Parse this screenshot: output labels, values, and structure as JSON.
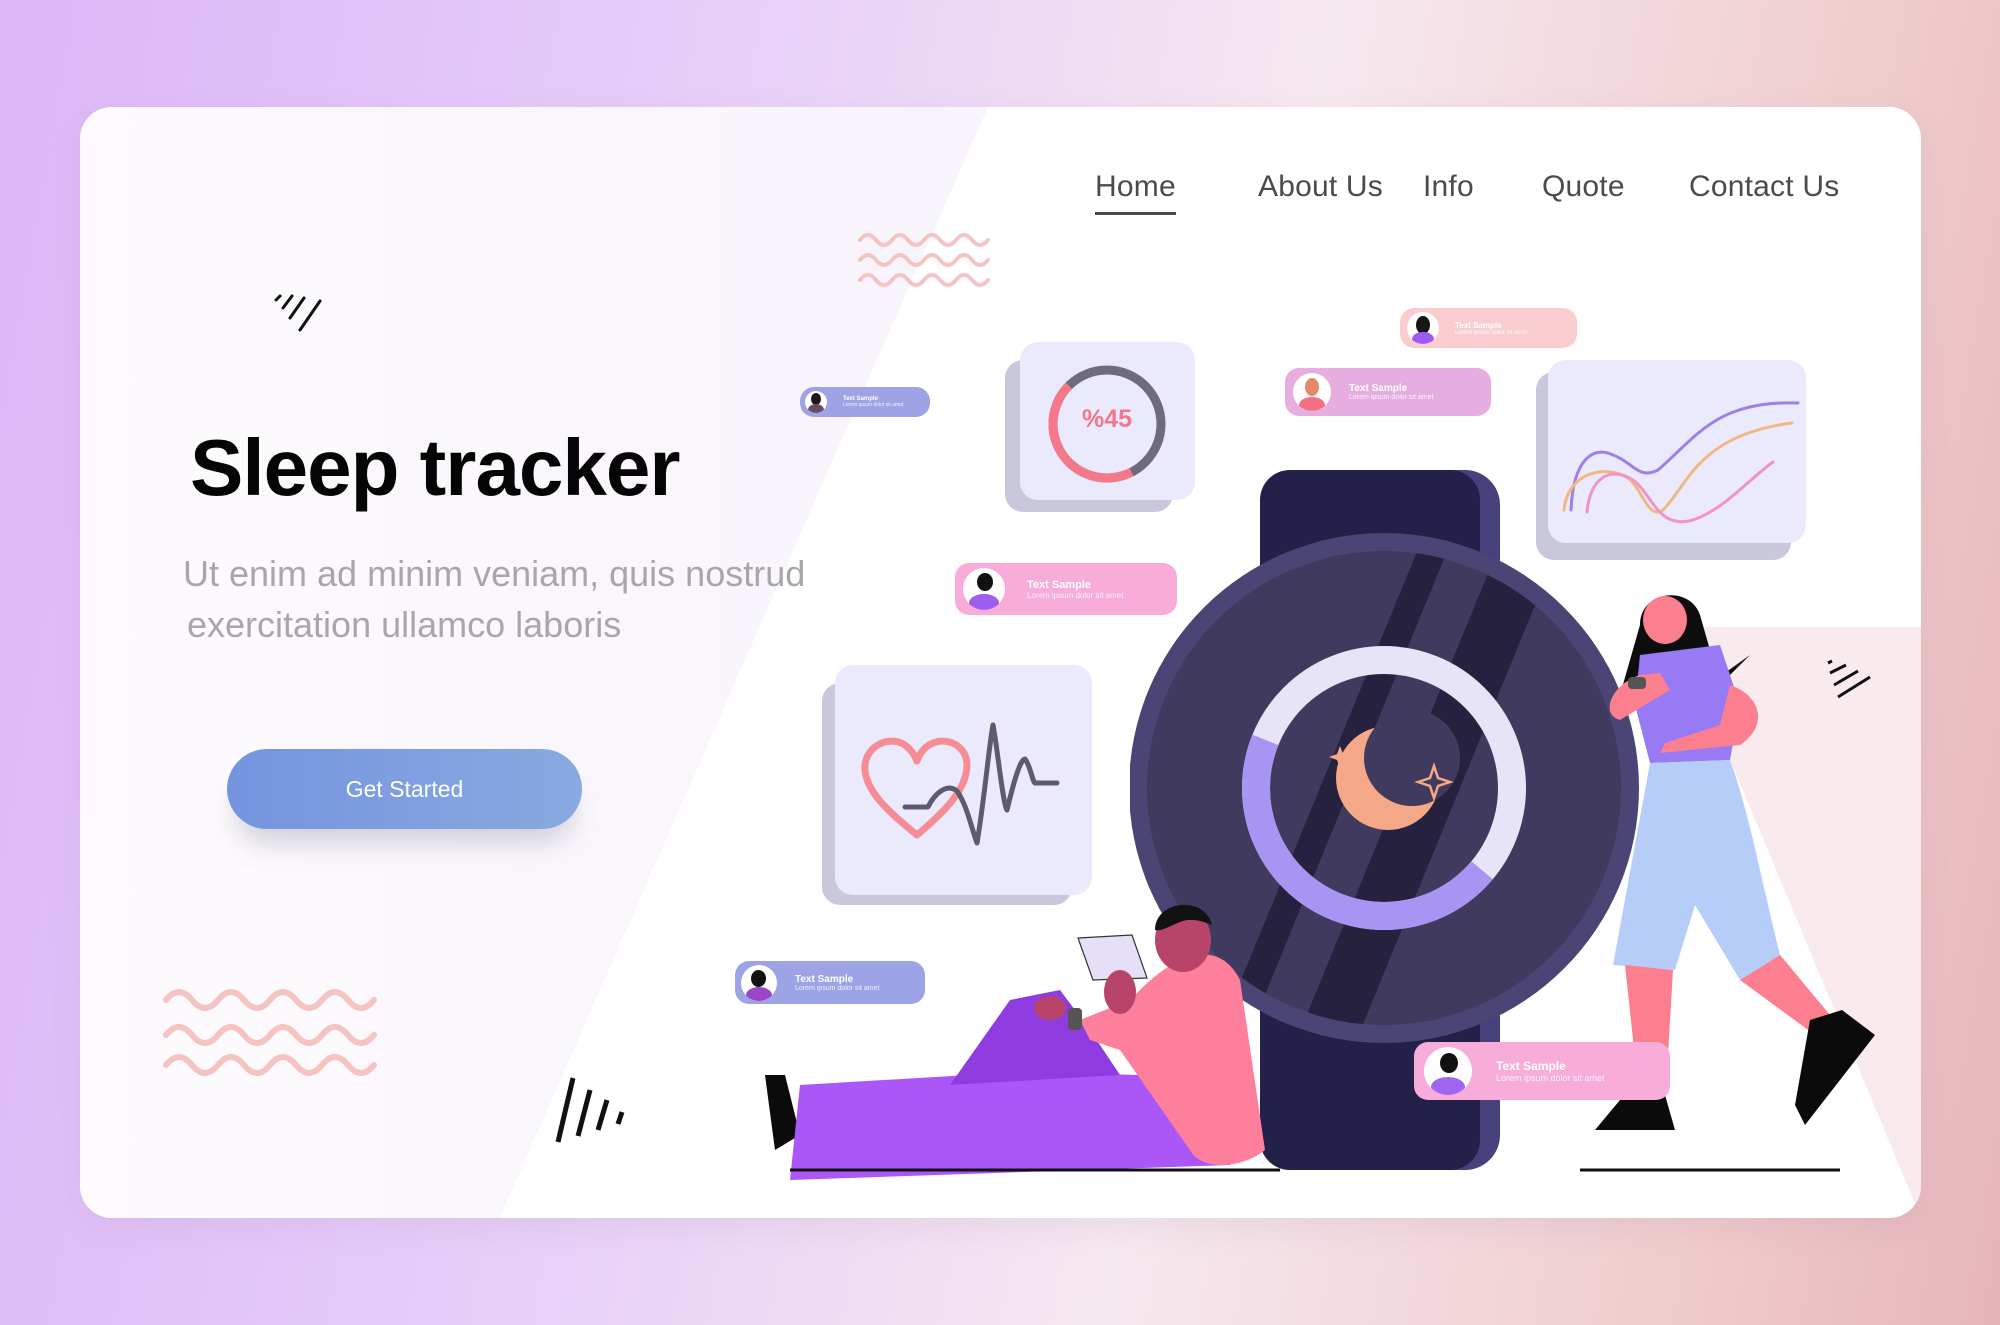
{
  "nav": {
    "items": [
      {
        "label": "Home",
        "active": true
      },
      {
        "label": "About Us",
        "active": false
      },
      {
        "label": "Info",
        "active": false
      },
      {
        "label": "Quote",
        "active": false
      },
      {
        "label": "Contact Us",
        "active": false
      }
    ]
  },
  "hero": {
    "title": "Sleep tracker",
    "subtitle_line1": "Ut enim ad minim veniam, quis nostrud",
    "subtitle_line2": "exercitation ullamco laboris",
    "cta_label": "Get Started"
  },
  "widgets": {
    "progress": {
      "label": "%45",
      "value_percent": 45
    },
    "watch_ring": {
      "progress_fraction": 0.45
    },
    "heart_icon": "heart-icon",
    "chart_icon": "line-chart-icon",
    "moon_icon": "moon-icon"
  },
  "bubbles": [
    {
      "title": "Text Sample",
      "text": "Lorem ipsum dolor sit amet",
      "color": "#9fa3e6"
    },
    {
      "title": "Text Sample",
      "text": "Lorem ipsum dolor sit amet",
      "color": "#f9cdd0"
    },
    {
      "title": "Text Sample",
      "text": "Lorem ipsum dolor sit amet",
      "color": "#e6aee0"
    },
    {
      "title": "Text Sample",
      "text": "Lorem ipsum dolor sit amet",
      "color": "#f7acd9"
    },
    {
      "title": "Text Sample",
      "text": "Lorem ipsum dolor sit amet",
      "color": "#9da4e6"
    },
    {
      "title": "Text Sample",
      "text": "Lorem ipsum dolor sit amet",
      "color": "#f7acd9"
    }
  ],
  "colors": {
    "accent_blue": "#7c9be0",
    "watch_dark": "#23204a",
    "watch_bezel": "#4a4575",
    "ring_purple": "#a895f3",
    "ring_light": "#e6e4f6",
    "moon": "#f4a888",
    "donut_pink": "#f5788a",
    "donut_gray": "#6e6a80"
  }
}
